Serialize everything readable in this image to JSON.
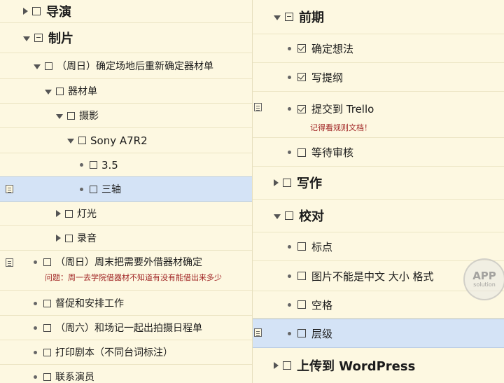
{
  "left": {
    "items": [
      {
        "label": "导演"
      },
      {
        "label": "制片"
      },
      {
        "label": "（周日）确定场地后重新确定器材单"
      },
      {
        "label": "器材单"
      },
      {
        "label": "摄影"
      },
      {
        "label": "Sony A7R2"
      },
      {
        "label": "3.5"
      },
      {
        "label": "三轴"
      },
      {
        "label": "灯光"
      },
      {
        "label": "录音"
      },
      {
        "label": "（周日）周末把需要外借器材确定",
        "note": "问题：周一去学院借器材不知道有没有能借出来多少"
      },
      {
        "label": "督促和安排工作"
      },
      {
        "label": "（周六）和场记一起出拍摄日程单"
      },
      {
        "label": "打印剧本（不同台词标注）"
      },
      {
        "label": "联系演员"
      }
    ]
  },
  "right": {
    "items": [
      {
        "label": "前期"
      },
      {
        "label": "确定想法"
      },
      {
        "label": "写提纲"
      },
      {
        "label": "提交到 Trello",
        "note": "记得看规则文档！"
      },
      {
        "label": "等待审核"
      },
      {
        "label": "写作"
      },
      {
        "label": "校对"
      },
      {
        "label": "标点"
      },
      {
        "label": "图片不能是中文 大小 格式"
      },
      {
        "label": "空格"
      },
      {
        "label": "层级"
      },
      {
        "label": "上传到 WordPress"
      }
    ]
  },
  "watermark": {
    "line1": "APP",
    "line2": "solution"
  }
}
